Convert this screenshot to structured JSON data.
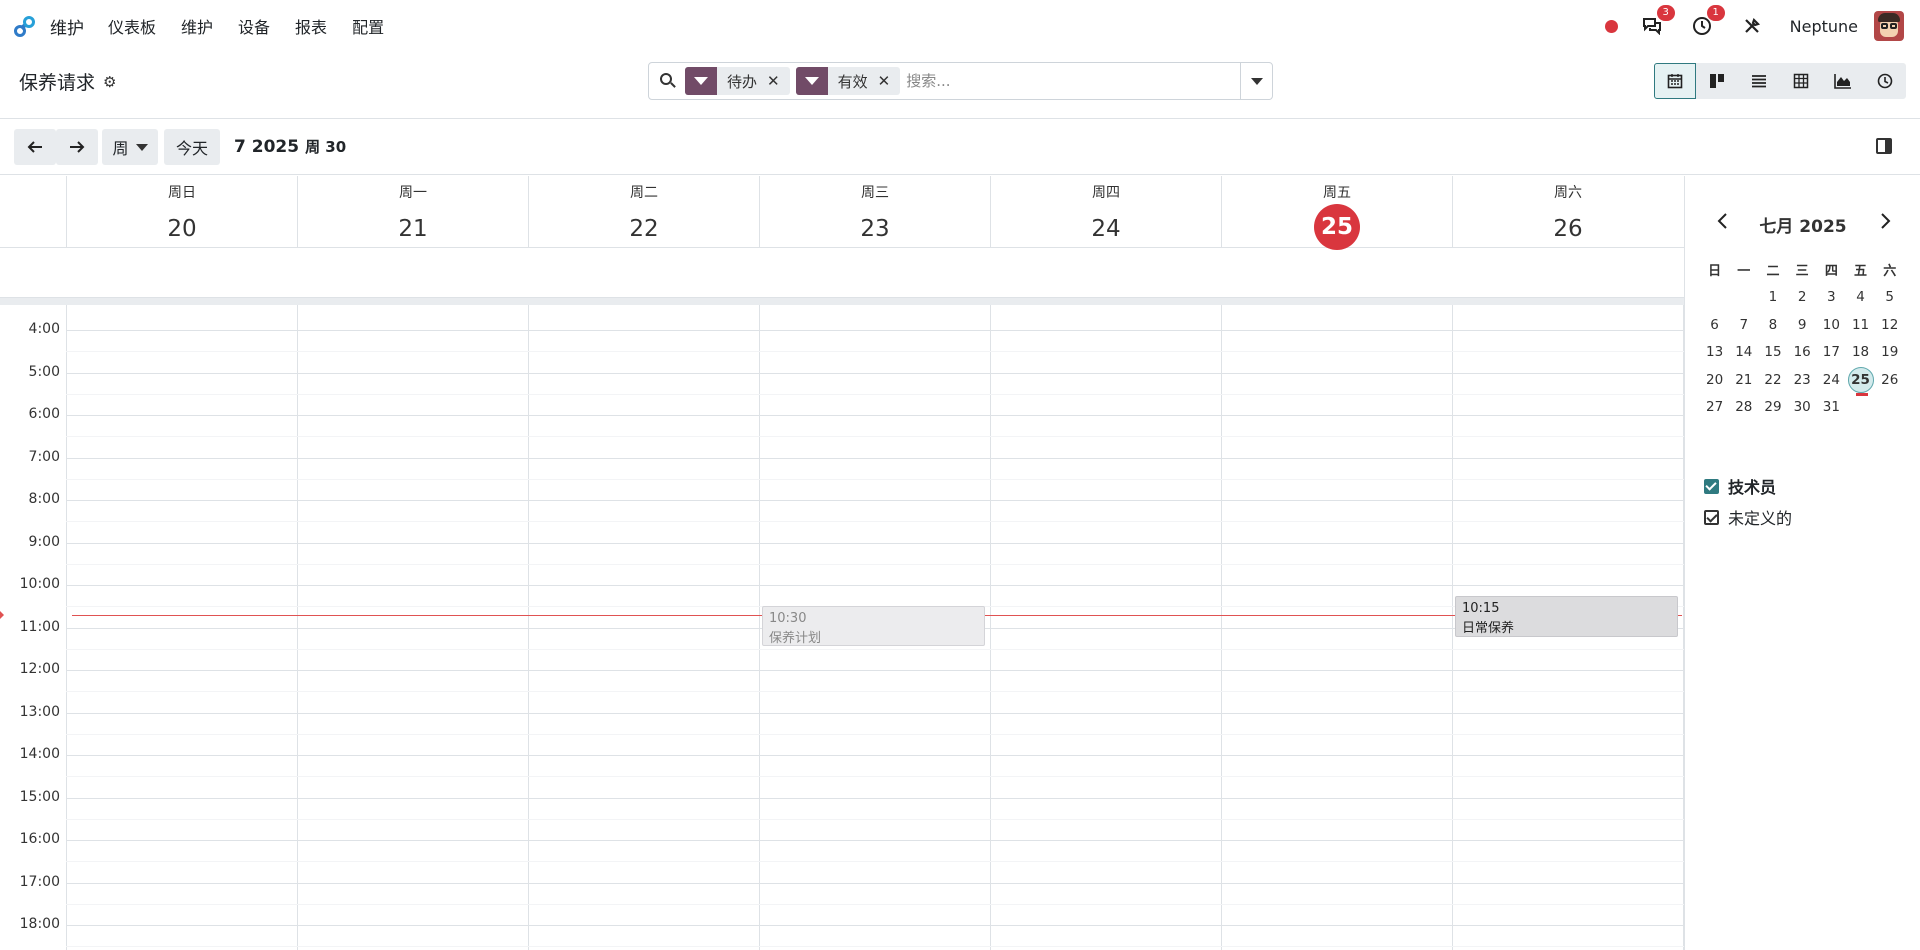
{
  "navbar": {
    "app_name": "维护",
    "menus": [
      "仪表板",
      "维护",
      "设备",
      "报表",
      "配置"
    ],
    "messages_count": "3",
    "activities_count": "1",
    "user_name": "Neptune"
  },
  "control_panel": {
    "title": "保养请求",
    "facets": [
      {
        "label": "待办",
        "icon": "filter-icon"
      },
      {
        "label": "有效",
        "icon": "filter-icon"
      }
    ],
    "search_placeholder": "搜索...",
    "views": [
      "calendar-view-icon",
      "kanban-view-icon",
      "list-view-icon",
      "pivot-view-icon",
      "graph-view-icon",
      "activity-view-icon"
    ],
    "active_view": "calendar-view-icon"
  },
  "calendar_toolbar": {
    "scale_label": "周",
    "today_label": "今天",
    "range_label": "7 2025",
    "week_label": "周 30"
  },
  "week": {
    "days": [
      {
        "name": "周日",
        "num": "20"
      },
      {
        "name": "周一",
        "num": "21"
      },
      {
        "name": "周二",
        "num": "22"
      },
      {
        "name": "周三",
        "num": "23"
      },
      {
        "name": "周四",
        "num": "24"
      },
      {
        "name": "周五",
        "num": "25",
        "today": true
      },
      {
        "name": "周六",
        "num": "26"
      }
    ],
    "hours": [
      "4:00",
      "5:00",
      "6:00",
      "7:00",
      "8:00",
      "9:00",
      "10:00",
      "11:00",
      "12:00",
      "13:00",
      "14:00",
      "15:00",
      "16:00",
      "17:00",
      "18:00"
    ],
    "events": [
      {
        "day": "周三",
        "time": "10:30",
        "title": "保养计划",
        "state": "past"
      },
      {
        "day": "周六",
        "time": "10:15",
        "title": "日常保养",
        "state": "current"
      }
    ]
  },
  "sidebar": {
    "month_title": "七月 2025",
    "weekday_headers": [
      "日",
      "一",
      "二",
      "三",
      "四",
      "五",
      "六"
    ],
    "weeks": [
      [
        "",
        "",
        "1",
        "2",
        "3",
        "4",
        "5"
      ],
      [
        "6",
        "7",
        "8",
        "9",
        "10",
        "11",
        "12"
      ],
      [
        "13",
        "14",
        "15",
        "16",
        "17",
        "18",
        "19"
      ],
      [
        "20",
        "21",
        "22",
        "23",
        "24",
        "25",
        "26"
      ],
      [
        "27",
        "28",
        "29",
        "30",
        "31",
        "",
        ""
      ]
    ],
    "today": "25",
    "filters": [
      {
        "label": "技术员",
        "checked": true,
        "style": "header"
      },
      {
        "label": "未定义的",
        "checked": true,
        "style": "item"
      }
    ]
  },
  "colors": {
    "accent": "#714b67",
    "today": "#d9363e",
    "teal": "#2f7a80"
  }
}
